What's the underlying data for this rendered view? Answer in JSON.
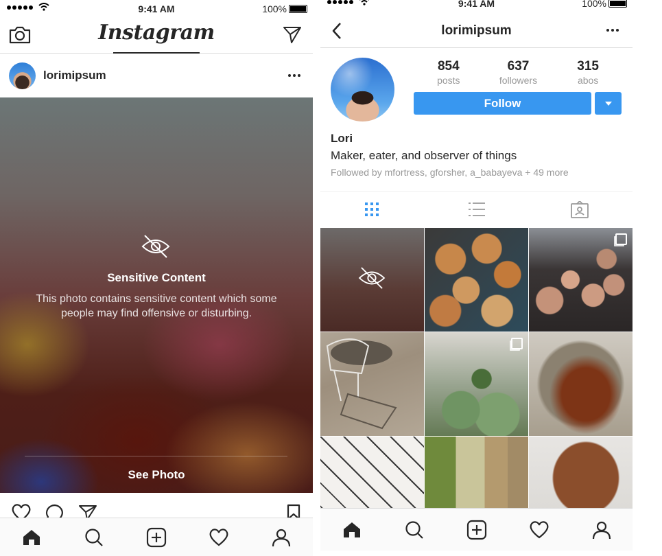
{
  "status_bar": {
    "time": "9:41 AM",
    "battery": "100%"
  },
  "feed": {
    "logo": "Instagram",
    "post": {
      "username": "lorimipsum",
      "sensitive_title": "Sensitive Content",
      "sensitive_description": "This photo contains sensitive content which some people may find offensive or disturbing.",
      "see_photo_label": "See Photo"
    },
    "icons": {
      "camera": "camera-icon",
      "direct": "paper-plane-icon",
      "more": "more-dots-icon",
      "hidden": "eye-slash-icon",
      "like": "heart-icon",
      "comment": "comment-icon",
      "share": "paper-plane-icon",
      "save": "bookmark-icon"
    }
  },
  "profile": {
    "username": "lorimipsum",
    "stats": [
      {
        "value": "854",
        "label": "posts"
      },
      {
        "value": "637",
        "label": "followers"
      },
      {
        "value": "315",
        "label": "abos"
      }
    ],
    "follow_label": "Follow",
    "name": "Lori",
    "bio": "Maker, eater, and observer of things",
    "followed_by": "Followed by mfortress, gforsher, a_babayeva + 49 more",
    "view_tabs": [
      "grid-icon",
      "list-icon",
      "tagged-icon"
    ],
    "grid": [
      {
        "description": "sensitive-hidden",
        "multi": false
      },
      {
        "description": "donuts",
        "multi": false
      },
      {
        "description": "group-selfie",
        "multi": true
      },
      {
        "description": "wire-chair-shadow",
        "multi": false
      },
      {
        "description": "succulents",
        "multi": true
      },
      {
        "description": "food-bowl",
        "multi": false
      },
      {
        "description": "geometric-tiles",
        "multi": false
      },
      {
        "description": "ice-cream-tubs",
        "multi": false
      },
      {
        "description": "wood-stool-card",
        "multi": false
      }
    ]
  },
  "tab_bar": [
    "home-icon",
    "search-icon",
    "add-post-icon",
    "activity-heart-icon",
    "profile-icon"
  ],
  "colors": {
    "accent": "#3897f0",
    "text": "#262626",
    "muted": "#999999",
    "divider": "#dbdbdb"
  }
}
